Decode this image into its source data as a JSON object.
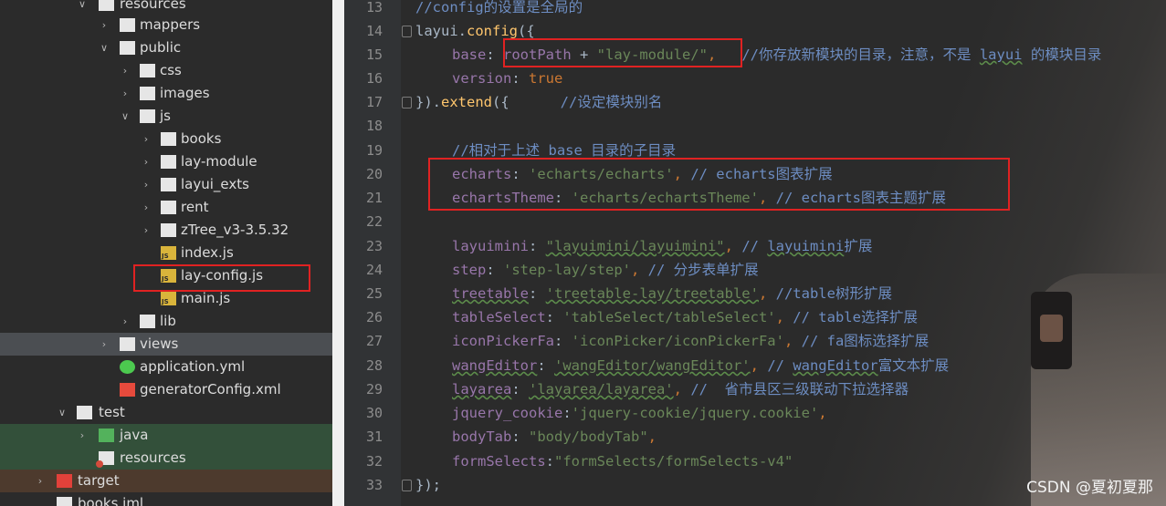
{
  "tree": {
    "items": [
      {
        "label": "resources",
        "arrow": "∨",
        "indent": 84
      },
      {
        "label": "mappers",
        "arrow": "›",
        "indent": 108
      },
      {
        "label": "public",
        "arrow": "∨",
        "indent": 108
      },
      {
        "label": "css",
        "arrow": "›",
        "indent": 131
      },
      {
        "label": "images",
        "arrow": "›",
        "indent": 131
      },
      {
        "label": "js",
        "arrow": "∨",
        "indent": 131
      },
      {
        "label": "books",
        "arrow": "›",
        "indent": 154
      },
      {
        "label": "lay-module",
        "arrow": "›",
        "indent": 154
      },
      {
        "label": "layui_exts",
        "arrow": "›",
        "indent": 154
      },
      {
        "label": "rent",
        "arrow": "›",
        "indent": 154
      },
      {
        "label": "zTree_v3-3.5.32",
        "arrow": "›",
        "indent": 154
      },
      {
        "label": "index.js",
        "arrow": "",
        "indent": 154
      },
      {
        "label": "lay-config.js",
        "arrow": "",
        "indent": 154
      },
      {
        "label": "main.js",
        "arrow": "",
        "indent": 154
      },
      {
        "label": "lib",
        "arrow": "›",
        "indent": 131
      },
      {
        "label": "views",
        "arrow": "›",
        "indent": 108
      },
      {
        "label": "application.yml",
        "arrow": "",
        "indent": 108
      },
      {
        "label": "generatorConfig.xml",
        "arrow": "",
        "indent": 108
      },
      {
        "label": "test",
        "arrow": "∨",
        "indent": 62
      },
      {
        "label": "java",
        "arrow": "›",
        "indent": 84
      },
      {
        "label": "resources",
        "arrow": "",
        "indent": 84
      },
      {
        "label": "target",
        "arrow": "›",
        "indent": 38
      },
      {
        "label": "books.iml",
        "arrow": "",
        "indent": 38
      }
    ]
  },
  "editor": {
    "line_numbers": [
      "13",
      "14",
      "15",
      "16",
      "17",
      "18",
      "19",
      "20",
      "21",
      "22",
      "23",
      "24",
      "25",
      "26",
      "27",
      "28",
      "29",
      "30",
      "31",
      "32",
      "33"
    ],
    "l13": {
      "c": "//config的设置是全局的"
    },
    "l14": {
      "a": "layui",
      "b": ".",
      "c": "config",
      "d": "({"
    },
    "l15": {
      "a": "base",
      "b": ": ",
      "c": "rootPath",
      "d": " + ",
      "e": "\"lay-module/\"",
      "f": ",",
      "g": "   //你存放新模块的目录，注意，不是 ",
      "h": "layui",
      "i": " 的模块目录"
    },
    "l16": {
      "a": "version",
      "b": ": ",
      "c": "true"
    },
    "l17": {
      "a": "})",
      "b": ".",
      "c": "extend",
      "d": "({",
      "e": "      //设定模块别名"
    },
    "l19": {
      "a": "//相对于上述 base 目录的子目录"
    },
    "l20": {
      "a": "echarts",
      "b": ": ",
      "c": "'echarts/echarts'",
      "d": ",",
      "e": " // echarts图表扩展"
    },
    "l21": {
      "a": "echartsTheme",
      "b": ": ",
      "c": "'echarts/echartsTheme'",
      "d": ",",
      "e": " // echarts图表主题扩展"
    },
    "l23": {
      "a": "layuimini",
      "b": ": ",
      "c": "\"layuimini/layuimini\"",
      "d": ",",
      "e": " // ",
      "f": "layuimini",
      "g": "扩展"
    },
    "l24": {
      "a": "step",
      "b": ": ",
      "c": "'step-lay/step'",
      "d": ",",
      "e": " // 分步表单扩展"
    },
    "l25": {
      "a": "treetable",
      "b": ": ",
      "c": "'treetable-lay/treetable'",
      "d": ",",
      "e": " //table树形扩展"
    },
    "l26": {
      "a": "tableSelect",
      "b": ": ",
      "c": "'tableSelect/tableSelect'",
      "d": ",",
      "e": " // table选择扩展"
    },
    "l27": {
      "a": "iconPickerFa",
      "b": ": ",
      "c": "'iconPicker/iconPickerFa'",
      "d": ",",
      "e": " // fa图标选择扩展"
    },
    "l28": {
      "a": "wangEditor",
      "b": ": ",
      "c": "'wangEditor/wangEditor'",
      "d": ",",
      "e": " // ",
      "f": "wangEditor",
      "g": "富文本扩展"
    },
    "l29": {
      "a": "layarea",
      "b": ": ",
      "c": "'layarea/layarea'",
      "d": ",",
      "e": " //  省市县区三级联动下拉选择器"
    },
    "l30": {
      "a": "jquery_cookie",
      "b": ":",
      "c": "'jquery-cookie/jquery.cookie'",
      "d": ","
    },
    "l31": {
      "a": "bodyTab",
      "b": ": ",
      "c": "\"body/bodyTab\"",
      "d": ","
    },
    "l32": {
      "a": "formSelects",
      "b": ":",
      "c": "\"formSelects/formSelects-v4\""
    },
    "l33": {
      "a": "});"
    }
  },
  "watermark": "CSDN @夏初夏那"
}
